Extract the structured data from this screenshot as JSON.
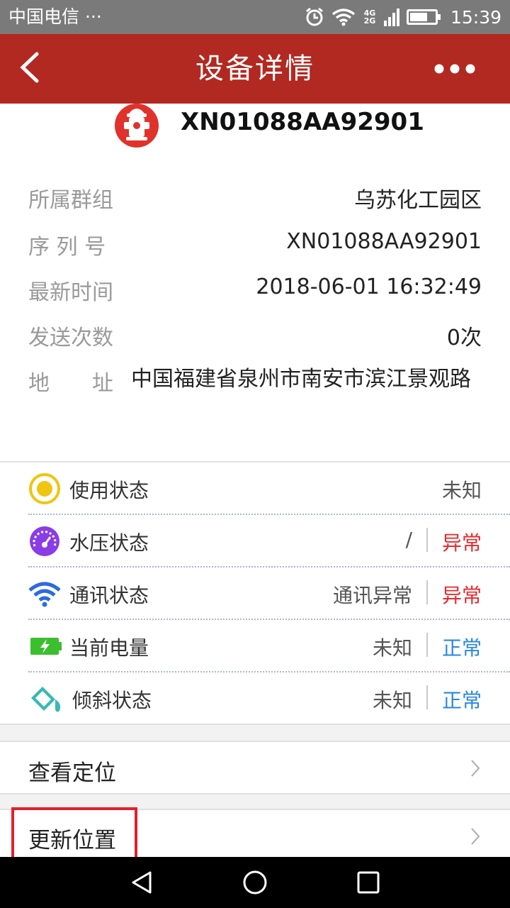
{
  "status_bar": {
    "carrier": "中国电信 ···",
    "network": "4G 2G",
    "time": "15:39",
    "battery_level": 0.72
  },
  "header": {
    "title": "设备详情"
  },
  "device": {
    "id": "XN01088AA92901"
  },
  "info": {
    "group_label": "所属群组",
    "group_value": "乌苏化工园区",
    "serial_label": "序 列 号",
    "serial_value": "XN01088AA92901",
    "time_label": "最新时间",
    "time_value": "2018-06-01 16:32:49",
    "count_label": "发送次数",
    "count_value": "0次",
    "address_label": "地　　址",
    "address_value": "中国福建省泉州市南安市滨江景观路"
  },
  "status_rows": [
    {
      "label": "使用状态",
      "value": "未知",
      "icon": "usage-status-icon",
      "color": "#f1c40f"
    },
    {
      "label": "水压状态",
      "value": "/",
      "state": "异常",
      "state_color": "#e8292c",
      "icon": "pressure-gauge-icon",
      "color": "#8a3ce6"
    },
    {
      "label": "通讯状态",
      "value": "通讯异常",
      "state": "异常",
      "state_color": "#e8292c",
      "icon": "wifi-signal-icon",
      "color": "#2a6be0"
    },
    {
      "label": "当前电量",
      "value": "未知",
      "state": "正常",
      "state_color": "#2a86e0",
      "icon": "battery-charge-icon",
      "color": "#3bbf2f"
    },
    {
      "label": "倾斜状态",
      "value": "未知",
      "state": "正常",
      "state_color": "#2a86e0",
      "icon": "tilt-bucket-icon",
      "color": "#3ab8b6"
    }
  ],
  "actions": {
    "view_location": "查看定位",
    "update_location": "更新位置"
  },
  "colors": {
    "header_bg": "#b22921",
    "status_bar_bg": "#7a7a7a",
    "highlight": "#e3202a"
  }
}
